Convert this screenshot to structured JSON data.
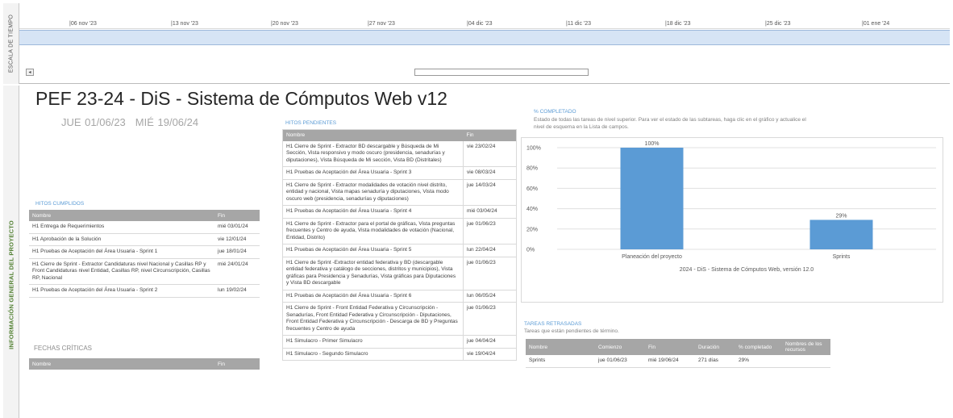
{
  "timescale": {
    "side_label": "ESCALA DE TIEMPO",
    "ticks": [
      "06 nov '23",
      "13 nov '23",
      "20 nov '23",
      "27 nov '23",
      "04 dic '23",
      "11 dic '23",
      "18 dic '23",
      "25 dic '23",
      "01 ene '24"
    ],
    "scroll_left": "◂"
  },
  "side_label": "INFORMACIÓN GENERAL DEL PROYECTO",
  "title": "PEF 23-24 - DiS - Sistema de Cómputos Web v12",
  "dates": {
    "start": "JUE 01/06/23",
    "end": "MIÉ 19/06/24"
  },
  "hitos_cumplidos": {
    "title": "HITOS CUMPLIDOS",
    "headers": [
      "Nombre",
      "Fin"
    ],
    "rows": [
      [
        "H1 Entrega de Requerimientos",
        "mié 03/01/24"
      ],
      [
        "H1 Aprobación de la Solución",
        "vie 12/01/24"
      ],
      [
        "H1 Pruebas de Aceptación del Área Usuaria - Sprint 1",
        "jue 18/01/24"
      ],
      [
        "H1 Cierre de Sprint - Extractor Candidaturas nivel Nacional y Casillas RP y Front Candidaturas nivel Entidad, Casillas RP, nivel Circunscripción, Casillas RP, Nacional",
        "mié 24/01/24"
      ],
      [
        "H1 Pruebas de Aceptación del Área Usuaria - Sprint 2",
        "lun 19/02/24"
      ]
    ]
  },
  "fechas_criticas": {
    "title": "FECHAS CRÍTICAS",
    "headers": [
      "Nombre",
      "Fin"
    ]
  },
  "hitos_pendientes": {
    "title": "HITOS PENDIENTES",
    "headers": [
      "Nombre",
      "Fin"
    ],
    "rows": [
      [
        "H1 Cierre de Sprint - Extractor BD descargable y Búsqueda de Mi Sección, Vista responsivo y modo oscuro (presidencia, senadurías y diputaciones), Vista Búsqueda de Mi sección, Vista BD (Distritales)",
        "vie 23/02/24"
      ],
      [
        "H1 Pruebas de Aceptación del Área Usuaria - Sprint 3",
        "vie 08/03/24"
      ],
      [
        "H1 Cierre de Sprint - Extractor modalidades de votación nivel distrito, entidad y nacional, Vista mapas senaduría y diputaciones, Vista modo oscuro web (presidencia, senadurías y diputaciones)",
        "jue 14/03/24"
      ],
      [
        "H1 Pruebas de Aceptación del Área Usuaria - Sprint 4",
        "mié 03/04/24"
      ],
      [
        "H1 Cierre de Sprint - Extractor para el portal de gráficas, Vista preguntas frecuentes y Centro de ayuda, Vista modalidades de votación (Nacional, Entidad, Distrito)",
        "jue 01/06/23"
      ],
      [
        "H1 Pruebas de Aceptación del Área Usuaria - Sprint 5",
        "lun 22/04/24"
      ],
      [
        "H1 Cierre de Sprint -Extractor entidad federativa y BD (descargable entidad federativa y catálogo de secciones, distritos y municipios), Vista gráficas para Presidencia y Senadurías, Vista gráficas para Diputaciones y Vista BD descargable",
        "jue 01/06/23"
      ],
      [
        "H1 Pruebas de Aceptación del Área Usuaria - Sprint 6",
        "lun 06/05/24"
      ],
      [
        "H1 Cierre de Sprint - Front Entidad Federativa y Circunscripción - Senadurías, Front Entidad Federativa y Circunscripción - Diputaciones, Front Entidad Federativa y Circunscripción - Descarga de BD y Preguntas frecuentes y Centro de ayuda",
        "jue 01/06/23"
      ],
      [
        "H1 Simulacro - Primer Simulacro",
        "jue 04/04/24"
      ],
      [
        "H1 Simulacro - Segundo Simulacro",
        "vie 19/04/24"
      ]
    ]
  },
  "completado": {
    "title": "% COMPLETADO",
    "subtitle": "Estado de todas las tareas de nivel superior. Para ver el estado de las subtareas, haga clic en el gráfico y actualice el nivel de esquema en la Lista de campos."
  },
  "chart_data": {
    "type": "bar",
    "categories": [
      "Planeación del proyecto",
      "Sprints"
    ],
    "values": [
      100,
      29
    ],
    "data_labels": [
      "100%",
      "29%"
    ],
    "y_ticks": [
      "0%",
      "20%",
      "40%",
      "60%",
      "80%",
      "100%"
    ],
    "ylim": [
      0,
      100
    ],
    "caption": "2024 - DiS - Sistema de Cómputos Web, versión 12.0",
    "bar_color": "#5b9bd5",
    "grid": true
  },
  "tareas_retrasadas": {
    "title": "TAREAS RETRASADAS",
    "subtitle": "Tareas que están pendientes de término.",
    "headers": [
      "Nombre",
      "Comienzo",
      "Fin",
      "Duración",
      "% completado",
      "Nombres de los recursos"
    ],
    "rows": [
      [
        "Sprints",
        "jue 01/06/23",
        "mié 19/06/24",
        "271 días",
        "29%",
        ""
      ]
    ]
  }
}
